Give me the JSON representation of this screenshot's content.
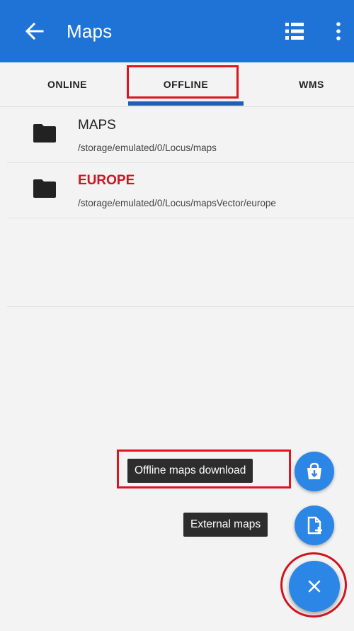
{
  "appbar": {
    "title": "Maps",
    "icons": [
      "back-arrow-icon",
      "list-view-icon",
      "more-vert-icon"
    ],
    "color": "#1f73d6"
  },
  "tabs": [
    {
      "label": "ONLINE"
    },
    {
      "label": "OFFLINE",
      "selected": true
    },
    {
      "label": "WMS"
    }
  ],
  "folders": [
    {
      "name": "MAPS",
      "path": "/storage/emulated/0/Locus/maps"
    },
    {
      "name": "EUROPE",
      "path": "/storage/emulated/0/Locus/mapsVector/europe",
      "highlight_color": "#d0141e"
    }
  ],
  "fab_menu": {
    "items": [
      {
        "label": "Offline maps download",
        "icon": "shopping-bag-download-icon"
      },
      {
        "label": "External maps",
        "icon": "add-file-icon"
      }
    ],
    "main_icon": "close-icon",
    "accent": "#2b86e6"
  },
  "annotation_color": "#e0141e"
}
